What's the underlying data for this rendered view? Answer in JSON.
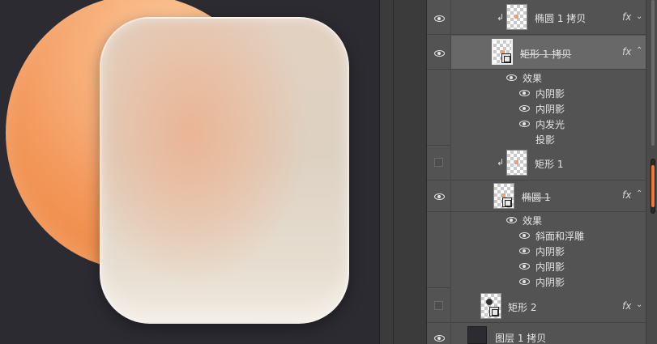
{
  "layers": [
    {
      "id": "ellipse-copy",
      "name": "椭圆 1 拷贝",
      "visible": true,
      "clipped": true,
      "fx": "fx",
      "strike": false
    },
    {
      "id": "rect-copy",
      "name": "矩形 1 拷贝",
      "visible": true,
      "clipped": false,
      "fx": "fx",
      "strike": true,
      "selected": true,
      "effects_label": "效果",
      "effects": [
        "内阴影",
        "内阴影",
        "内发光",
        "投影"
      ]
    },
    {
      "id": "rect-1",
      "name": "矩形 1",
      "visible": false,
      "clipped": true,
      "fx": "",
      "strike": false
    },
    {
      "id": "ellipse-1",
      "name": "椭圆 1",
      "visible": true,
      "clipped": false,
      "fx": "fx",
      "strike": true,
      "effects_label": "效果",
      "effects": [
        "斜面和浮雕",
        "内阴影",
        "内阴影",
        "内阴影"
      ]
    },
    {
      "id": "rect-2",
      "name": "矩形 2",
      "visible": false,
      "clipped": false,
      "fx": "fx",
      "strike": false
    },
    {
      "id": "layer-copy",
      "name": "图层 1 拷贝",
      "visible": true,
      "clipped": false,
      "fx": "",
      "strike": false
    }
  ],
  "icons": {
    "clip": "↲",
    "chevron": "⌃"
  },
  "colors": {
    "accent": "#f07830",
    "panel": "#535353",
    "selected": "#686868"
  }
}
